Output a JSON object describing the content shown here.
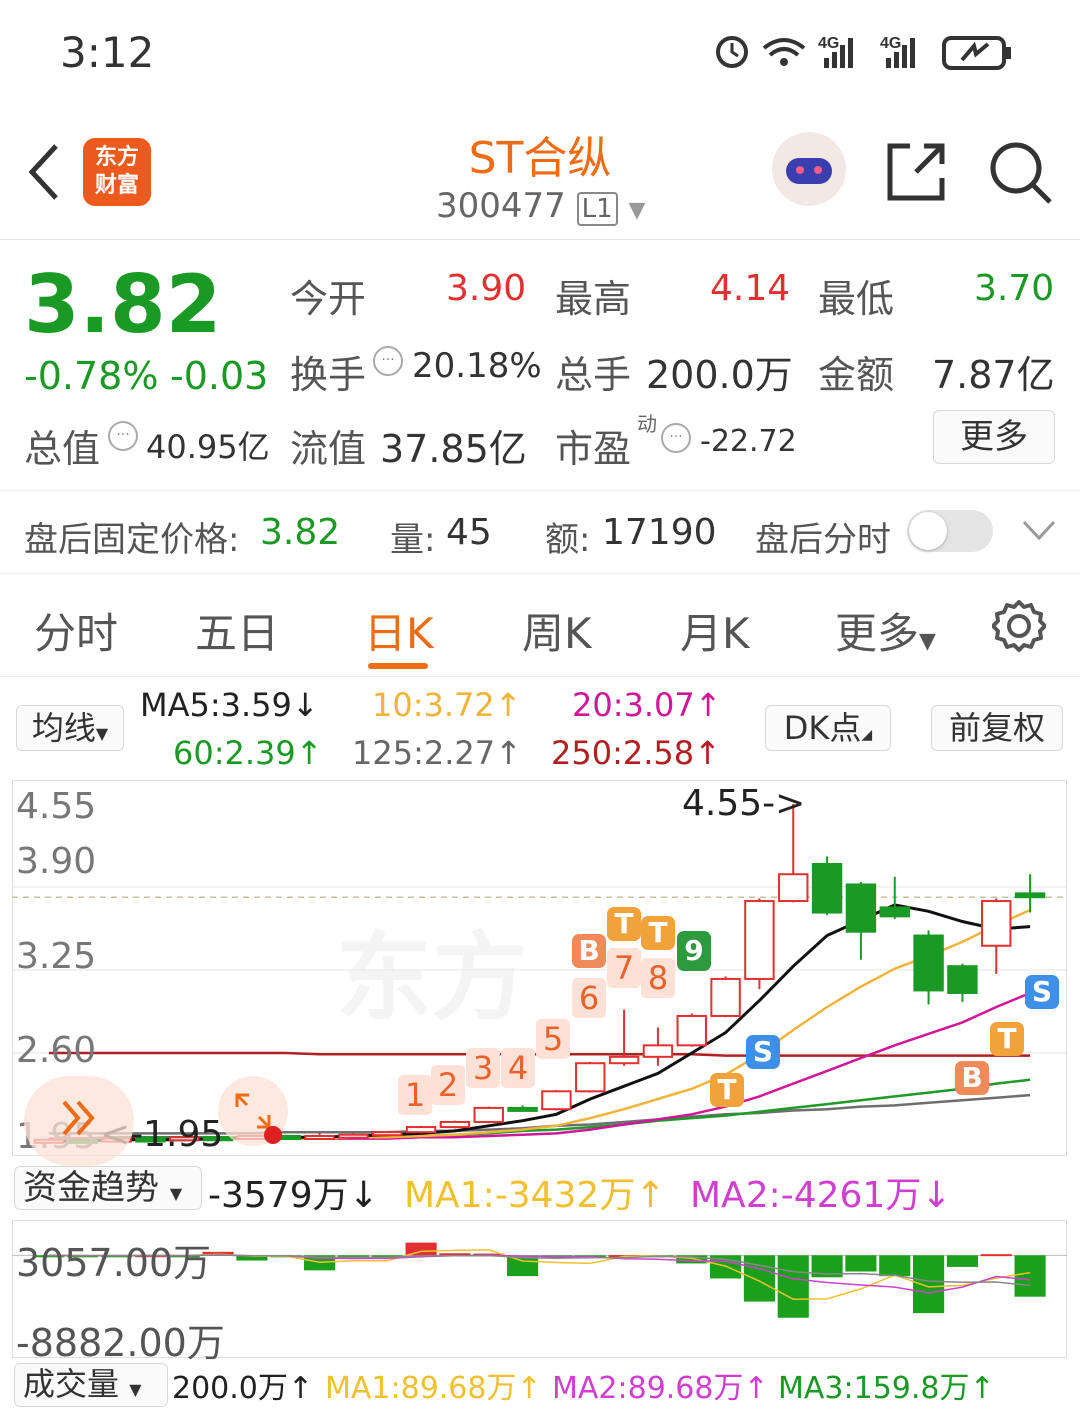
{
  "status": {
    "time": "3:12",
    "net1": "4G",
    "net2": "4G"
  },
  "header": {
    "title": "ST合纵",
    "code": "300477",
    "level": "L1",
    "logo_line1": "东方",
    "logo_line2": "财富"
  },
  "quote": {
    "price": "3.82",
    "change_pct": "-0.78%",
    "change": "-0.03",
    "open_label": "今开",
    "open": "3.90",
    "high_label": "最高",
    "high": "4.14",
    "low_label": "最低",
    "low": "3.70",
    "turnover_label": "换手",
    "turnover": "20.18%",
    "volume_label": "总手",
    "volume": "200.0万",
    "amount_label": "金额",
    "amount": "7.87亿",
    "mktcap_label": "总值",
    "mktcap": "40.95亿",
    "float_label": "流值",
    "float": "37.85亿",
    "pe_label": "市盈",
    "pe_sup": "动",
    "pe": "-22.72",
    "more": "更多"
  },
  "afterhours": {
    "price_label": "盘后固定价格:",
    "price": "3.82",
    "vol_label": "量:",
    "vol": "45",
    "amt_label": "额:",
    "amt": "17190",
    "toggle_label": "盘后分时",
    "toggle_on": false
  },
  "tabs": [
    "分时",
    "五日",
    "日K",
    "周K",
    "月K",
    "更多"
  ],
  "active_tab": "日K",
  "ma": {
    "selector": "均线",
    "ma5": "MA5:3.59",
    "ma10": "10:3.72",
    "ma20": "20:3.07",
    "ma60": "60:2.39",
    "ma125": "125:2.27",
    "ma250": "250:2.58",
    "dk": "DK点",
    "adjust": "前复权"
  },
  "chart_axes": {
    "y_ticks": [
      "4.55",
      "3.90",
      "3.25",
      "2.60",
      "1.95"
    ],
    "high_marker": "4.55->",
    "low_marker": "<-1.95"
  },
  "signals": {
    "b": "B",
    "t": "T",
    "s": "S",
    "counts": [
      "1",
      "2",
      "3",
      "4",
      "5",
      "6",
      "7",
      "8",
      "9"
    ]
  },
  "fund": {
    "selector": "资金趋势",
    "value": "-3579万",
    "ma1": "MA1:-3432万",
    "ma2": "MA2:-4261万",
    "top": "3057.00万",
    "bottom": "-8882.00万"
  },
  "volume_bar": {
    "selector": "成交量",
    "value": "200.0万",
    "ma1": "MA1:89.68万",
    "ma2": "MA2:89.68万",
    "ma3": "MA3:159.8万"
  },
  "colors": {
    "up": "#e03030",
    "down": "#1a9a24",
    "accent": "#ef6c16",
    "ma10": "#f0b43a",
    "ma20": "#d0179a",
    "ma60": "#1e9a2a",
    "ma125": "#6e6e6e",
    "ma250": "#b02020"
  },
  "chart_data": {
    "type": "candlestick",
    "ylim": [
      1.95,
      4.55
    ],
    "candles": [
      {
        "o": 1.9,
        "c": 1.92,
        "h": 1.93,
        "l": 1.89
      },
      {
        "o": 1.92,
        "c": 1.91,
        "h": 1.93,
        "l": 1.9
      },
      {
        "o": 1.91,
        "c": 1.93,
        "h": 1.94,
        "l": 1.9
      },
      {
        "o": 1.93,
        "c": 1.92,
        "h": 1.94,
        "l": 1.91
      },
      {
        "o": 1.92,
        "c": 1.94,
        "h": 1.95,
        "l": 1.91
      },
      {
        "o": 1.94,
        "c": 1.93,
        "h": 1.95,
        "l": 1.92
      },
      {
        "o": 1.93,
        "c": 1.95,
        "h": 1.96,
        "l": 1.92
      },
      {
        "o": 1.95,
        "c": 1.94,
        "h": 1.96,
        "l": 1.93
      },
      {
        "o": 1.94,
        "c": 1.95,
        "h": 1.97,
        "l": 1.93
      },
      {
        "o": 1.95,
        "c": 1.96,
        "h": 1.97,
        "l": 1.94
      },
      {
        "o": 1.96,
        "c": 1.98,
        "h": 1.99,
        "l": 1.95
      },
      {
        "o": 1.98,
        "c": 2.02,
        "h": 2.03,
        "l": 1.97
      },
      {
        "o": 2.02,
        "c": 2.06,
        "h": 2.07,
        "l": 2.01
      },
      {
        "o": 2.06,
        "c": 2.17,
        "h": 2.18,
        "l": 2.05
      },
      {
        "o": 2.17,
        "c": 2.16,
        "h": 2.19,
        "l": 2.14
      },
      {
        "o": 2.16,
        "c": 2.3,
        "h": 2.31,
        "l": 2.15
      },
      {
        "o": 2.3,
        "c": 2.52,
        "h": 2.53,
        "l": 2.29
      },
      {
        "o": 2.52,
        "c": 2.57,
        "h": 2.94,
        "l": 2.5
      },
      {
        "o": 2.57,
        "c": 2.66,
        "h": 2.8,
        "l": 2.5
      },
      {
        "o": 2.66,
        "c": 2.89,
        "h": 2.91,
        "l": 2.65
      },
      {
        "o": 2.89,
        "c": 3.18,
        "h": 3.2,
        "l": 2.88
      },
      {
        "o": 3.18,
        "c": 3.79,
        "h": 3.81,
        "l": 3.1
      },
      {
        "o": 3.79,
        "c": 4.0,
        "h": 4.55,
        "l": 3.78
      },
      {
        "o": 4.08,
        "c": 3.7,
        "h": 4.14,
        "l": 3.68
      },
      {
        "o": 3.92,
        "c": 3.55,
        "h": 3.94,
        "l": 3.33
      },
      {
        "o": 3.74,
        "c": 3.67,
        "h": 3.98,
        "l": 3.65
      },
      {
        "o": 3.52,
        "c": 3.09,
        "h": 3.56,
        "l": 2.98
      },
      {
        "o": 3.28,
        "c": 3.07,
        "h": 3.3,
        "l": 3.0
      },
      {
        "o": 3.44,
        "c": 3.79,
        "h": 3.81,
        "l": 3.22
      },
      {
        "o": 3.85,
        "c": 3.82,
        "h": 4.0,
        "l": 3.7
      }
    ],
    "ma5": [
      1.91,
      1.91,
      1.92,
      1.92,
      1.92,
      1.93,
      1.94,
      1.94,
      1.94,
      1.95,
      1.96,
      1.97,
      1.99,
      2.03,
      2.07,
      2.12,
      2.24,
      2.34,
      2.44,
      2.6,
      2.76,
      3.01,
      3.28,
      3.52,
      3.64,
      3.76,
      3.71,
      3.63,
      3.57,
      3.59
    ],
    "ma10": [
      1.92,
      1.92,
      1.92,
      1.92,
      1.92,
      1.93,
      1.93,
      1.93,
      1.93,
      1.94,
      1.94,
      1.95,
      1.96,
      1.98,
      2.0,
      2.03,
      2.09,
      2.16,
      2.24,
      2.32,
      2.43,
      2.59,
      2.78,
      2.96,
      3.12,
      3.26,
      3.36,
      3.47,
      3.6,
      3.72
    ],
    "ma20": [
      1.93,
      1.93,
      1.93,
      1.93,
      1.93,
      1.93,
      1.93,
      1.93,
      1.93,
      1.93,
      1.93,
      1.94,
      1.94,
      1.95,
      1.96,
      1.97,
      2.0,
      2.04,
      2.08,
      2.12,
      2.18,
      2.26,
      2.36,
      2.46,
      2.56,
      2.66,
      2.75,
      2.84,
      2.96,
      3.07
    ],
    "ma60": [
      1.93,
      1.93,
      1.94,
      1.94,
      1.94,
      1.94,
      1.94,
      1.94,
      1.94,
      1.94,
      1.95,
      1.95,
      1.96,
      1.97,
      1.99,
      2.0,
      2.02,
      2.04,
      2.07,
      2.09,
      2.11,
      2.14,
      2.17,
      2.2,
      2.23,
      2.26,
      2.29,
      2.32,
      2.36,
      2.39
    ],
    "ma125": [
      1.97,
      1.97,
      1.97,
      1.97,
      1.97,
      1.97,
      1.97,
      1.98,
      1.98,
      1.98,
      1.98,
      1.99,
      1.99,
      2.0,
      2.01,
      2.03,
      2.04,
      2.06,
      2.08,
      2.1,
      2.12,
      2.13,
      2.15,
      2.16,
      2.18,
      2.19,
      2.21,
      2.23,
      2.25,
      2.27
    ],
    "ma250": [
      2.6,
      2.6,
      2.6,
      2.6,
      2.6,
      2.6,
      2.6,
      2.6,
      2.59,
      2.59,
      2.59,
      2.59,
      2.59,
      2.59,
      2.59,
      2.59,
      2.59,
      2.59,
      2.59,
      2.59,
      2.58,
      2.58,
      2.58,
      2.58,
      2.58,
      2.58,
      2.58,
      2.58,
      2.58,
      2.58
    ],
    "fund_flow": [
      -3,
      -40,
      -30,
      10,
      -50,
      300,
      -450,
      -40,
      -1300,
      -80,
      -10,
      1100,
      180,
      150,
      -1800,
      -200,
      -100,
      20,
      -100,
      -700,
      -2000,
      -4000,
      -5400,
      -1900,
      -1400,
      -1800,
      -5000,
      -1000,
      100,
      -3579
    ],
    "fund_ylim": [
      -8882,
      3057
    ]
  }
}
